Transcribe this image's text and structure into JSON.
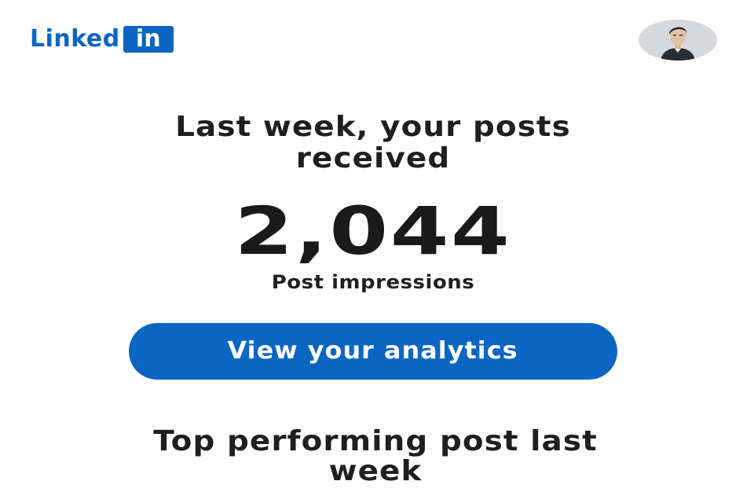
{
  "header": {
    "logo_text": "Linked",
    "logo_badge": "in",
    "avatar_icon": "profile-photo"
  },
  "summary": {
    "headline_line1": "Last week, your posts",
    "headline_line2": "received",
    "impressions_value": "2,044",
    "impressions_label": "Post impressions"
  },
  "cta": {
    "label": "View your analytics"
  },
  "top_post": {
    "title_line1": "Top performing post last",
    "title_line2": "week"
  },
  "colors": {
    "brand": "#0a66c2",
    "text": "#1d1d1d",
    "background": "#ffffff"
  }
}
